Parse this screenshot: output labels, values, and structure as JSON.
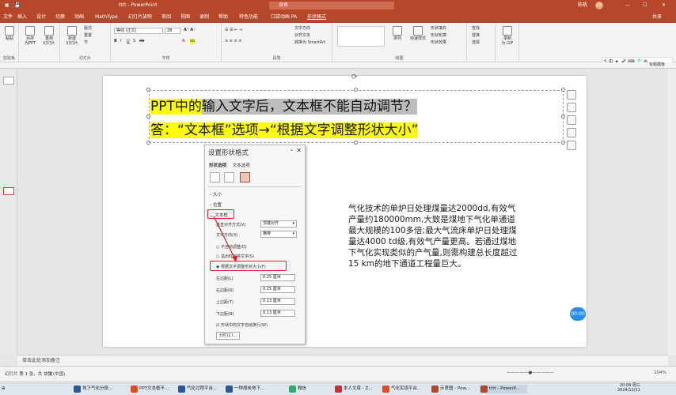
{
  "title_bar": {
    "doc_title": "tttt  -  PowerPoint",
    "search": "搜索",
    "user": "陈帆",
    "user_initials": "CF"
  },
  "tabs": [
    "文件",
    "插入",
    "设计",
    "切换",
    "动画",
    "MathType",
    "幻灯片放映",
    "审阅",
    "视图",
    "录制",
    "帮助",
    "特色功能",
    "口袋动画 PA",
    "形状格式"
  ],
  "active_tab": "开始",
  "share": "共享",
  "ribbon": {
    "groups": [
      "剪贴板",
      "幻灯片",
      "字体",
      "段落",
      "绘图"
    ],
    "new_slide": "新建\n幻灯片",
    "reuse": "重用\n幻灯片",
    "layout": "版式",
    "reset": "重置",
    "section": "节",
    "font_name": "等线 (正文)",
    "font_size": "28",
    "text_direction": "文字方向",
    "align_text": "对齐文本",
    "smartart": "转换为 SmartArt",
    "shape_fill": "形状填充",
    "shape_outline": "形状轮廓",
    "shape_effect": "形状效果",
    "find": "查找",
    "replace": "替换",
    "select": "选择",
    "record_gif": "录制\n为 GIF",
    "arrange": "排列",
    "quick_styles": "快速样式",
    "paste": "粘贴",
    "save": "另存\n为PPT"
  },
  "sogou_bar": "S 中 ✦ 🎤 ⌨ 👕 ⚙",
  "sidebar_right": "标题模板",
  "slide": {
    "line1_hl": "PPT中的",
    "line1_sel": "输入文字后，文本框不能自动调节？",
    "line2": "答：“文本框”选项→“根据文字调整形状大小”",
    "paragraph": "气化技术的单炉日处理煤量达2000dd,有效气产量约180000mm,大致是煤地下气化单通道最大规模的100多倍;最大气流床单炉日处理煤量达4000 td级,有效气产量更高。若通过煤地下气化实现类似的产气量,则需构建总长度超过 15 km的地下通道工程量巨大。"
  },
  "panel": {
    "title": "设置形状格式",
    "tab1": "形状选项",
    "tab2": "文本选项",
    "size": "大小",
    "position": "位置",
    "textbox": "文本框",
    "valign_label": "垂直对齐方式(V)",
    "valign_value": "顶端对齐",
    "textdir_label": "文字方向(X)",
    "textdir_value": "横排",
    "no_autofit": "不自动调整(D)",
    "shrink": "溢出时缩排文字(S)",
    "resize": "根据文字调整形状大小(F)",
    "left_label": "左边距(L)",
    "left_value": "0.25 厘米",
    "right_label": "右边距(R)",
    "right_value": "0.25 厘米",
    "top_label": "上边距(T)",
    "top_value": "0.13 厘米",
    "bottom_label": "下边距(B)",
    "bottom_value": "0.13 厘米",
    "wrap": "形状中的文字自动换行(W)",
    "columns": "分栏(C)..."
  },
  "notes": "单击此处添加备注",
  "status": {
    "slide": "幻灯片 第 1 张，共 1 张",
    "lang": "中文(中国)",
    "zoom": "104%"
  },
  "bubble": "00:00",
  "taskbar": {
    "items": [
      "地下气化分段...",
      "PPT文本框不...",
      "气化过程平台...",
      "一种煤炭地下...",
      "微信",
      "本人文章 - Z...",
      "气化实现平台...",
      "示意图 - Pow...",
      "tttt - PowerP..."
    ],
    "time": "20:09 周三",
    "date": "2024/12/11"
  },
  "colors": {
    "brand": "#b7472a",
    "highlight": "#ffff00",
    "selection": "#bdbdbd",
    "callout": "#e02020",
    "bubble": "#2b8cf0"
  }
}
